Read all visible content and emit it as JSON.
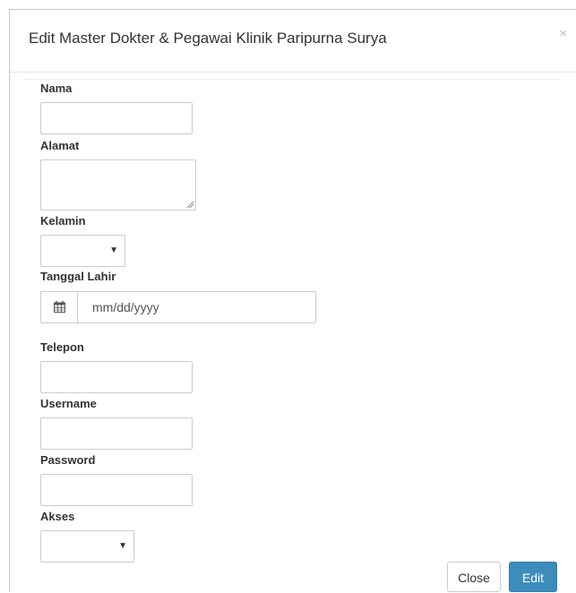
{
  "modal": {
    "title": "Edit Master Dokter & Pegawai Klinik Paripurna Surya",
    "close_symbol": "×"
  },
  "form": {
    "nama": {
      "label": "Nama",
      "value": ""
    },
    "alamat": {
      "label": "Alamat",
      "value": ""
    },
    "kelamin": {
      "label": "Kelamin",
      "selected": "",
      "caret": "▼"
    },
    "tanggal_lahir": {
      "label": "Tanggal Lahir",
      "placeholder": "mm/dd/yyyy",
      "icon": "calendar-icon"
    },
    "telepon": {
      "label": "Telepon",
      "value": ""
    },
    "username": {
      "label": "Username",
      "value": ""
    },
    "password": {
      "label": "Password",
      "value": ""
    },
    "akses": {
      "label": "Akses",
      "selected": "",
      "caret": "▼"
    }
  },
  "footer": {
    "close_label": "Close",
    "edit_label": "Edit"
  },
  "colors": {
    "primary": "#3c8dbc",
    "border": "#cccccc"
  }
}
